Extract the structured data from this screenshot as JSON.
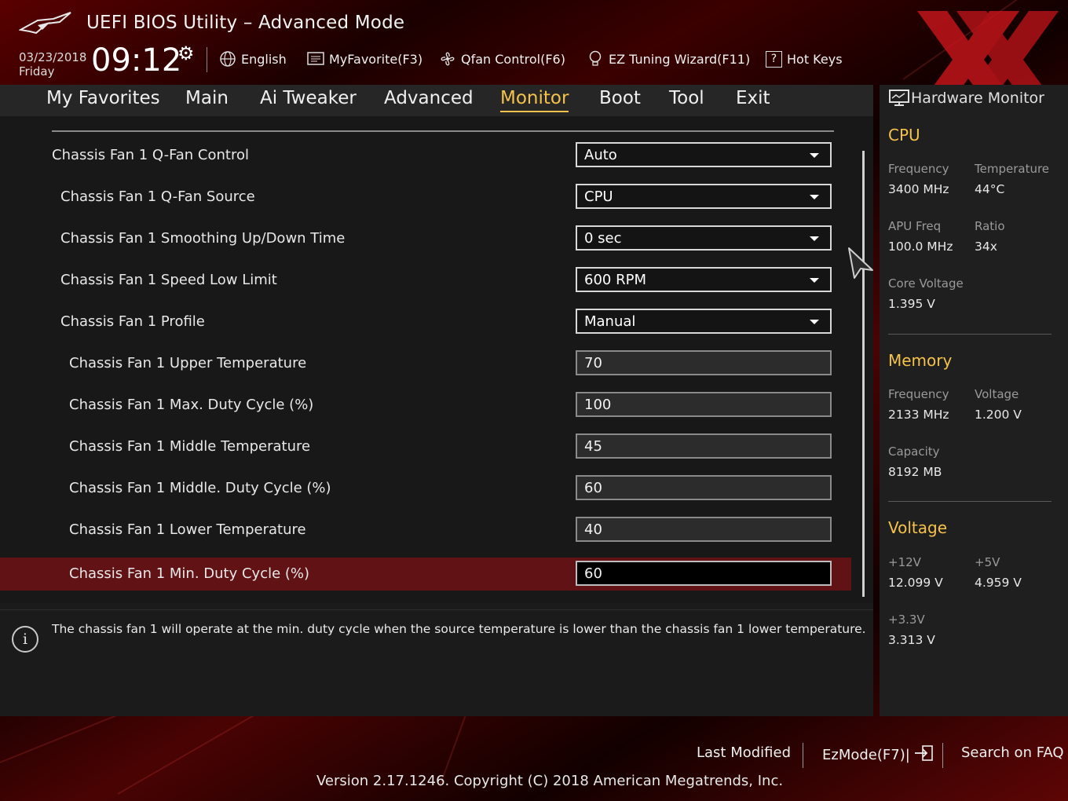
{
  "app_title": "UEFI BIOS Utility – Advanced Mode",
  "datetime": {
    "date": "03/23/2018",
    "day": "Friday",
    "time": "09:12"
  },
  "toolbar": {
    "language": "English",
    "favorite": "MyFavorite(F3)",
    "qfan": "Qfan Control(F6)",
    "ez_tuning": "EZ Tuning Wizard(F11)",
    "hot_keys": "Hot Keys"
  },
  "tabs": [
    {
      "label": "My Favorites",
      "active": false
    },
    {
      "label": "Main",
      "active": false
    },
    {
      "label": "Ai Tweaker",
      "active": false
    },
    {
      "label": "Advanced",
      "active": false
    },
    {
      "label": "Monitor",
      "active": true
    },
    {
      "label": "Boot",
      "active": false
    },
    {
      "label": "Tool",
      "active": false
    },
    {
      "label": "Exit",
      "active": false
    }
  ],
  "settings": [
    {
      "label": "Chassis Fan 1 Q-Fan Control",
      "type": "dropdown",
      "value": "Auto",
      "indent": 0
    },
    {
      "label": "Chassis Fan 1 Q-Fan Source",
      "type": "dropdown",
      "value": "CPU",
      "indent": 1
    },
    {
      "label": "Chassis Fan 1 Smoothing Up/Down Time",
      "type": "dropdown",
      "value": "0 sec",
      "indent": 1
    },
    {
      "label": "Chassis Fan 1 Speed Low Limit",
      "type": "dropdown",
      "value": "600 RPM",
      "indent": 1
    },
    {
      "label": "Chassis Fan 1 Profile",
      "type": "dropdown",
      "value": "Manual",
      "indent": 1
    },
    {
      "label": "Chassis Fan 1 Upper Temperature",
      "type": "input",
      "value": "70",
      "indent": 2
    },
    {
      "label": "Chassis Fan 1 Max. Duty Cycle (%)",
      "type": "input",
      "value": "100",
      "indent": 2
    },
    {
      "label": "Chassis Fan 1 Middle Temperature",
      "type": "input",
      "value": "45",
      "indent": 2
    },
    {
      "label": "Chassis Fan 1 Middle. Duty Cycle (%)",
      "type": "input",
      "value": "60",
      "indent": 2
    },
    {
      "label": "Chassis Fan 1 Lower Temperature",
      "type": "input",
      "value": "40",
      "indent": 2
    },
    {
      "label": "Chassis Fan 1 Min. Duty Cycle (%)",
      "type": "input",
      "value": "60",
      "indent": 2,
      "selected": true
    }
  ],
  "help_text": "The chassis fan 1 will operate at the min. duty cycle when the source temperature is lower than the chassis fan 1 lower temperature.",
  "hardware_monitor": {
    "title": "Hardware Monitor",
    "cpu": {
      "heading": "CPU",
      "frequency_label": "Frequency",
      "frequency": "3400 MHz",
      "temperature_label": "Temperature",
      "temperature": "44°C",
      "apu_freq_label": "APU Freq",
      "apu_freq": "100.0 MHz",
      "ratio_label": "Ratio",
      "ratio": "34x",
      "core_voltage_label": "Core Voltage",
      "core_voltage": "1.395 V"
    },
    "memory": {
      "heading": "Memory",
      "frequency_label": "Frequency",
      "frequency": "2133 MHz",
      "voltage_label": "Voltage",
      "voltage": "1.200 V",
      "capacity_label": "Capacity",
      "capacity": "8192 MB"
    },
    "voltage": {
      "heading": "Voltage",
      "v12_label": "+12V",
      "v12": "12.099 V",
      "v5_label": "+5V",
      "v5": "4.959 V",
      "v33_label": "+3.3V",
      "v33": "3.313 V"
    }
  },
  "footer": {
    "last_modified": "Last Modified",
    "ez_mode": "EzMode(F7)|",
    "search_faq": "Search on FAQ",
    "version": "Version 2.17.1246. Copyright (C) 2018 American Megatrends, Inc."
  },
  "colors": {
    "accent": "#f5c24b",
    "selected_row": "#611214",
    "brand_red": "#c0141a"
  }
}
